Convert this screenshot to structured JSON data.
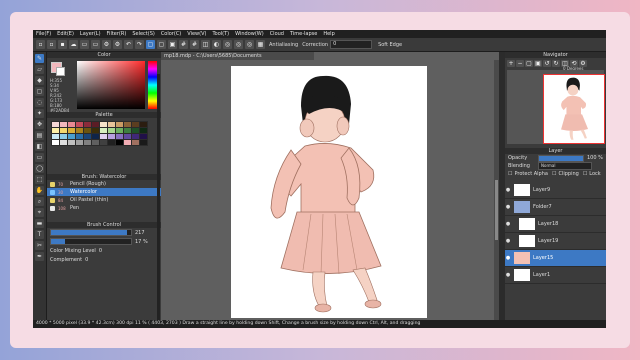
{
  "menu": [
    "File(F)",
    "Edit(E)",
    "Layer(L)",
    "Filter(R)",
    "Select(S)",
    "Color(C)",
    "View(V)",
    "Tool(T)",
    "Window(W)",
    "Cloud",
    "Time-lapse",
    "Help"
  ],
  "toolbar": {
    "antialiasing": "Antialiasing",
    "correction": "Correction",
    "correction_value": "0",
    "soft_edge": "Soft Edge"
  },
  "document_tab": "mp18.mdp - C:\\Users\\5685\\Documents",
  "color_panel": {
    "title": "Color",
    "values": [
      "H:355",
      "S:34",
      "V:95",
      "R:242",
      "G:173",
      "B:180",
      "#F2ADB4"
    ],
    "accent": "#f2b8bd"
  },
  "palette_panel": {
    "title": "Palette"
  },
  "brush_panel": {
    "title": "Brush: Watercolor",
    "items": [
      {
        "size": "70",
        "name": "Pencil (Rough)",
        "color": "#e8d36a"
      },
      {
        "size": "30",
        "name": "Watercolor",
        "color": "#7ac4ff",
        "selected": true
      },
      {
        "size": "84",
        "name": "Oil Pastel (thin)",
        "color": "#e8d36a"
      },
      {
        "size": "108",
        "name": "Pen",
        "color": "#e8e8e8"
      }
    ]
  },
  "brush_control": {
    "title": "Brush Control",
    "size_value": "217",
    "size_fill": 0.95,
    "opacity_value": "17 %",
    "opacity_fill": 0.17,
    "color_mixing_label": "Color Mixing Level",
    "color_mixing_value": "0",
    "complement_label": "Complement",
    "complement_value": "0"
  },
  "navigator": {
    "title": "Navigator",
    "rotation": "0 Degrees"
  },
  "layer_panel": {
    "title": "Layer",
    "opacity_label": "Opacity",
    "opacity_value": "100 %",
    "blending_label": "Blending",
    "blending_value": "Normal",
    "protect_alpha": "Protect Alpha",
    "clipping": "Clipping",
    "lock": "Lock",
    "layers": [
      {
        "name": "Layer9",
        "indent": 0
      },
      {
        "name": "Folder7",
        "indent": 0,
        "folder": true
      },
      {
        "name": "Layer18",
        "indent": 1
      },
      {
        "name": "Layer19",
        "indent": 1
      },
      {
        "name": "Layer15",
        "indent": 0,
        "selected": true
      },
      {
        "name": "Layer1",
        "indent": 0
      }
    ]
  },
  "status": {
    "size": "4000 * 5000 pixel",
    "dims": "(33.9 * 42.3cm)",
    "dpi": "300 dpi",
    "zoom": "11 %",
    "coords": "( 4403, 2703 )",
    "hint": "Draw a straight line by holding down Shift, Change a brush size by holding down Ctrl, Alt, and dragging"
  }
}
